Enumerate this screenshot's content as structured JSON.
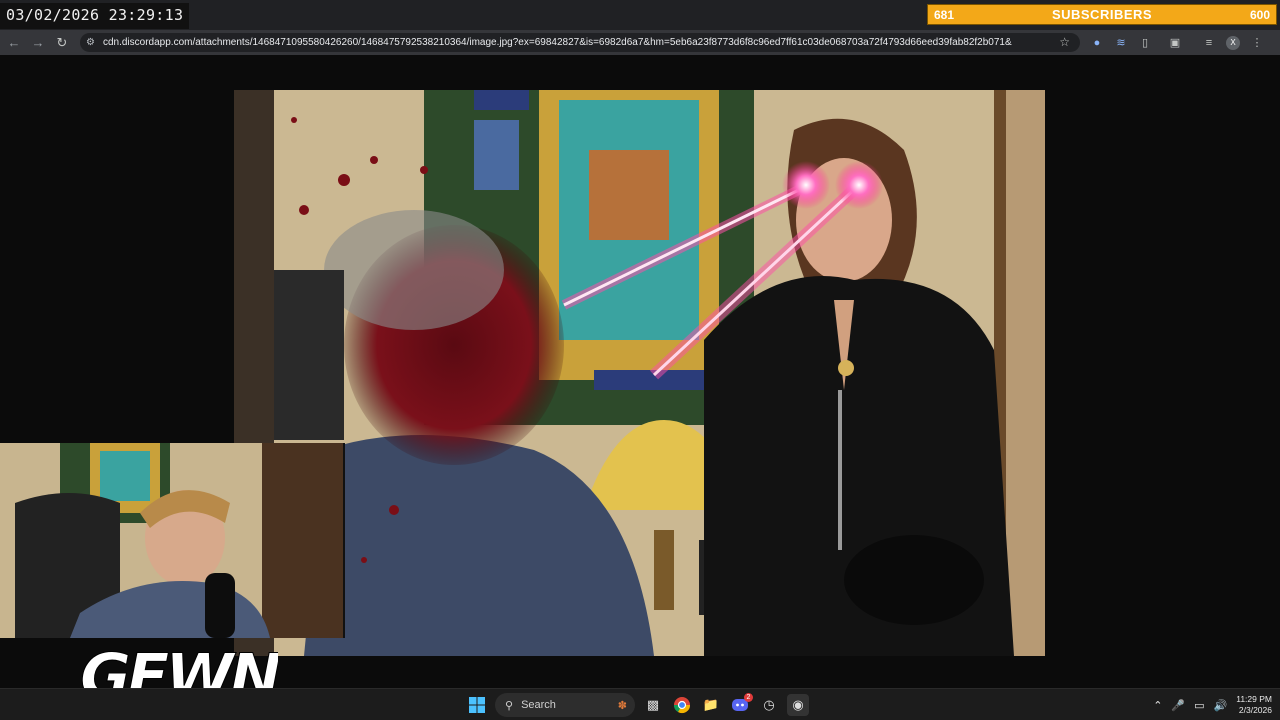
{
  "overlay": {
    "timestamp": "03/02/2026 23:29:13",
    "subscribers": {
      "current": "681",
      "label": "SUBSCRIBERS",
      "goal": "600",
      "color": "#f3a818"
    }
  },
  "browser": {
    "url": "cdn.discordapp.com/attachments/1468471095580426260/1468475792538210364/image.jpg?ex=69842827&is=6982d6a7&hm=5eb6a23f8773d6f8c96ed7ff61c03de068703a72f4793d66eed39fab82f2b071&",
    "icons": [
      "back-icon",
      "forward-icon",
      "reload-icon",
      "site-settings-icon",
      "bookmark-star-icon",
      "extensions-icon"
    ]
  },
  "stream": {
    "logo_text": "GEWN"
  },
  "taskbar": {
    "search_label": "Search",
    "time": "11:29 PM",
    "date": "2/3/2026",
    "apps": [
      "start",
      "search",
      "task-view",
      "chrome",
      "file-explorer",
      "discord",
      "clock-app",
      "obs"
    ],
    "discord_badge": "2",
    "accent": "#0078d4"
  }
}
